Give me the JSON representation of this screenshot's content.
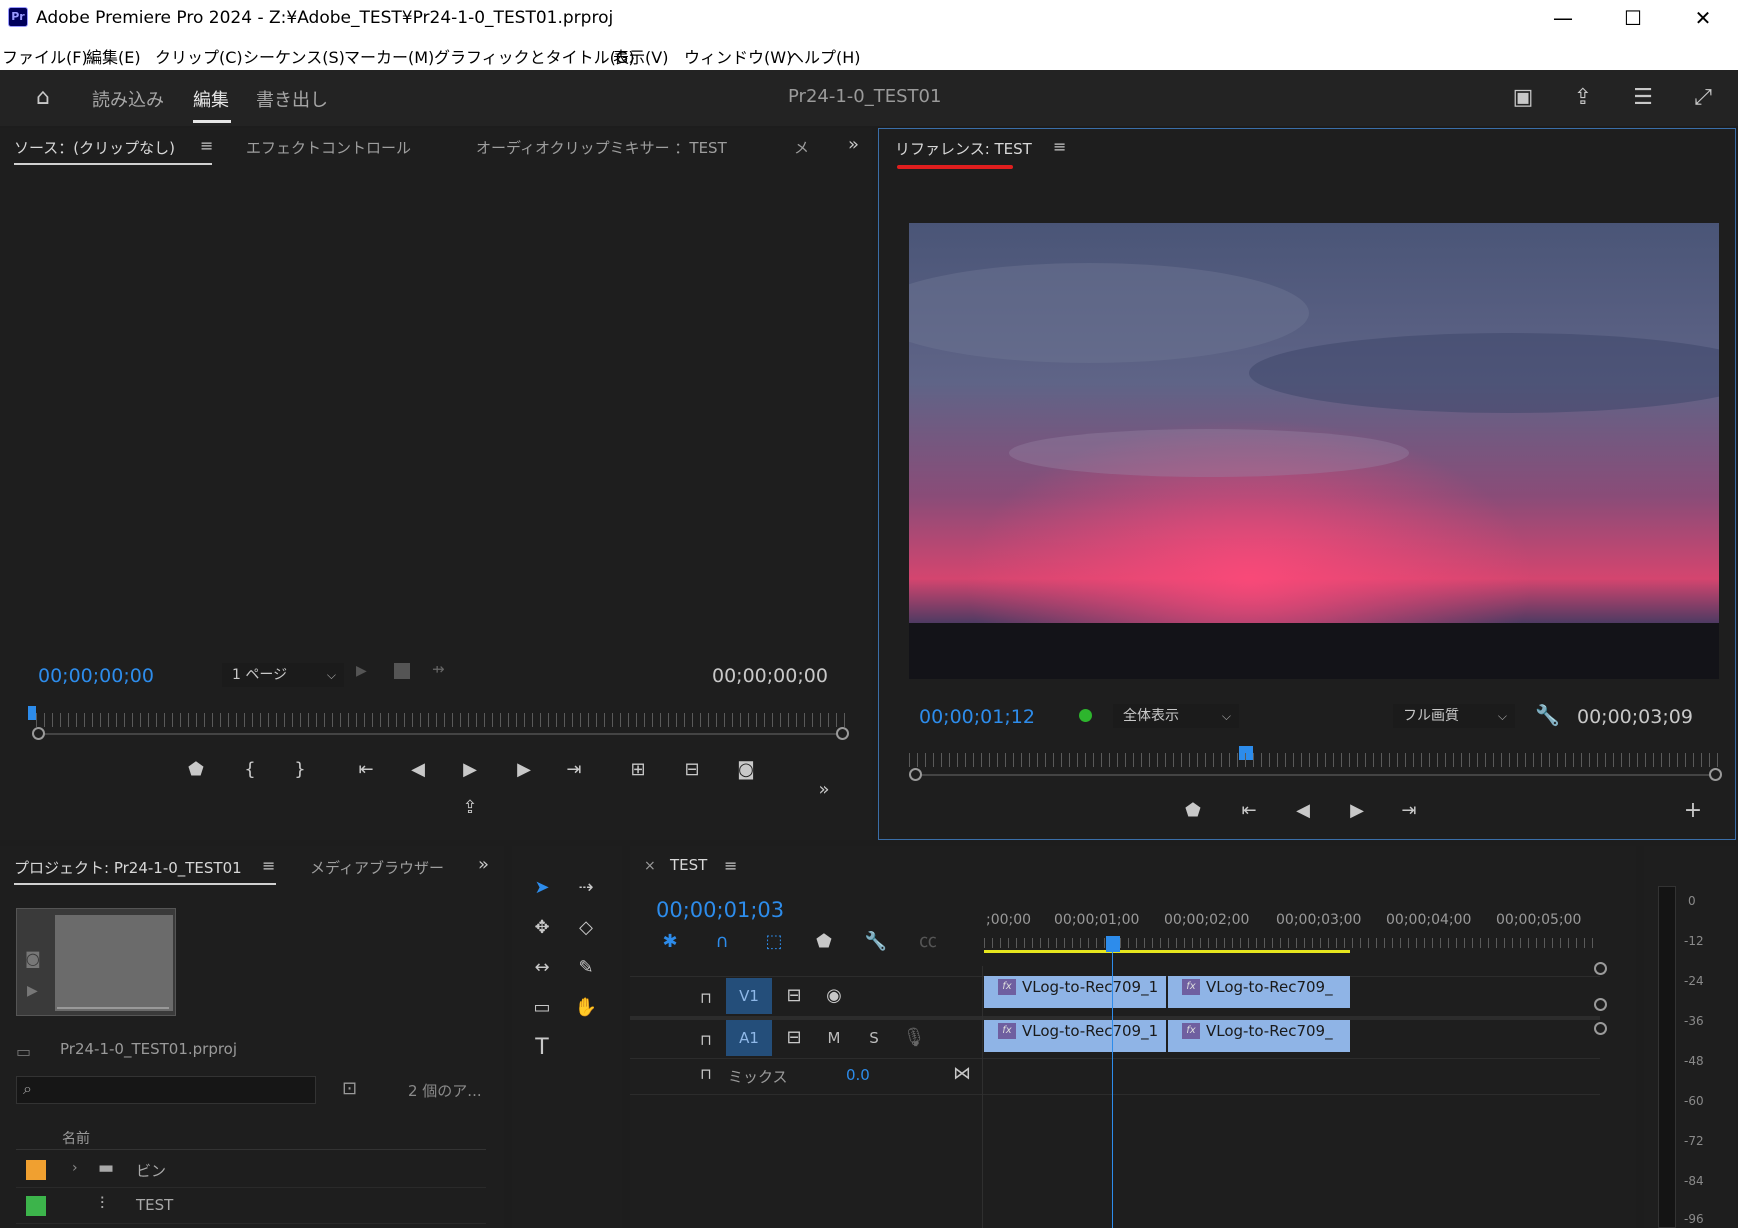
{
  "window": {
    "title": "Adobe Premiere Pro 2024 - Z:¥Adobe_TEST¥Pr24-1-0_TEST01.prproj",
    "app_icon": "Pr"
  },
  "menu": [
    "ファイル(F)",
    "編集(E)",
    "クリップ(C)",
    "シーケンス(S)",
    "マーカー(M)",
    "グラフィックとタイトル(G)",
    "表示(V)",
    "ウィンドウ(W)",
    "ヘルプ(H)"
  ],
  "header": {
    "workspaces": [
      "読み込み",
      "編集",
      "書き出し"
    ],
    "active_workspace": "編集",
    "project_title": "Pr24-1-0_TEST01"
  },
  "source_panel": {
    "tabs": [
      "ソース：(クリップなし)",
      "エフェクトコントロール",
      "オーディオクリップミキサー ：TEST",
      "メ"
    ],
    "timecode_in": "00;00;00;00",
    "timecode_out": "00;00;00;00",
    "page_select": "1 ページ"
  },
  "reference_panel": {
    "tab": "リファレンス: TEST",
    "timecode_current": "00;00;01;12",
    "timecode_duration": "00;00;03;09",
    "fit_select": "全体表示",
    "quality_select": "フル画質",
    "status_color": "#2db52d"
  },
  "project_panel": {
    "tabs": [
      "プロジェクト: Pr24-1-0_TEST01",
      "メディアブラウザー"
    ],
    "file": "Pr24-1-0_TEST01.prproj",
    "item_count": "2 個のア...",
    "column_name": "名前",
    "items": [
      {
        "name": "ビン",
        "color": "#f0a030"
      },
      {
        "name": "TEST",
        "color": "#3cb44b"
      }
    ]
  },
  "timeline": {
    "tab": "TEST",
    "timecode": "00;00;01;03",
    "ruler": [
      ";00;00",
      "00;00;01;00",
      "00;00;02;00",
      "00;00;03;00",
      "00;00;04;00",
      "00;00;05;00"
    ],
    "tracks": {
      "v1": "V1",
      "a1": "A1",
      "mute": "M",
      "solo": "S",
      "mix_label": "ミックス",
      "mix_value": "0.0"
    },
    "clips_v1": [
      "VLog-to-Rec709_1",
      "VLog-to-Rec709_"
    ],
    "clips_a1": [
      "VLog-to-Rec709_1",
      "VLog-to-Rec709_"
    ],
    "fx_label": "fx"
  },
  "audio_meter": {
    "labels": [
      "0",
      "-12",
      "-24",
      "-36",
      "-48",
      "-60",
      "-72",
      "-84",
      "-96"
    ]
  }
}
